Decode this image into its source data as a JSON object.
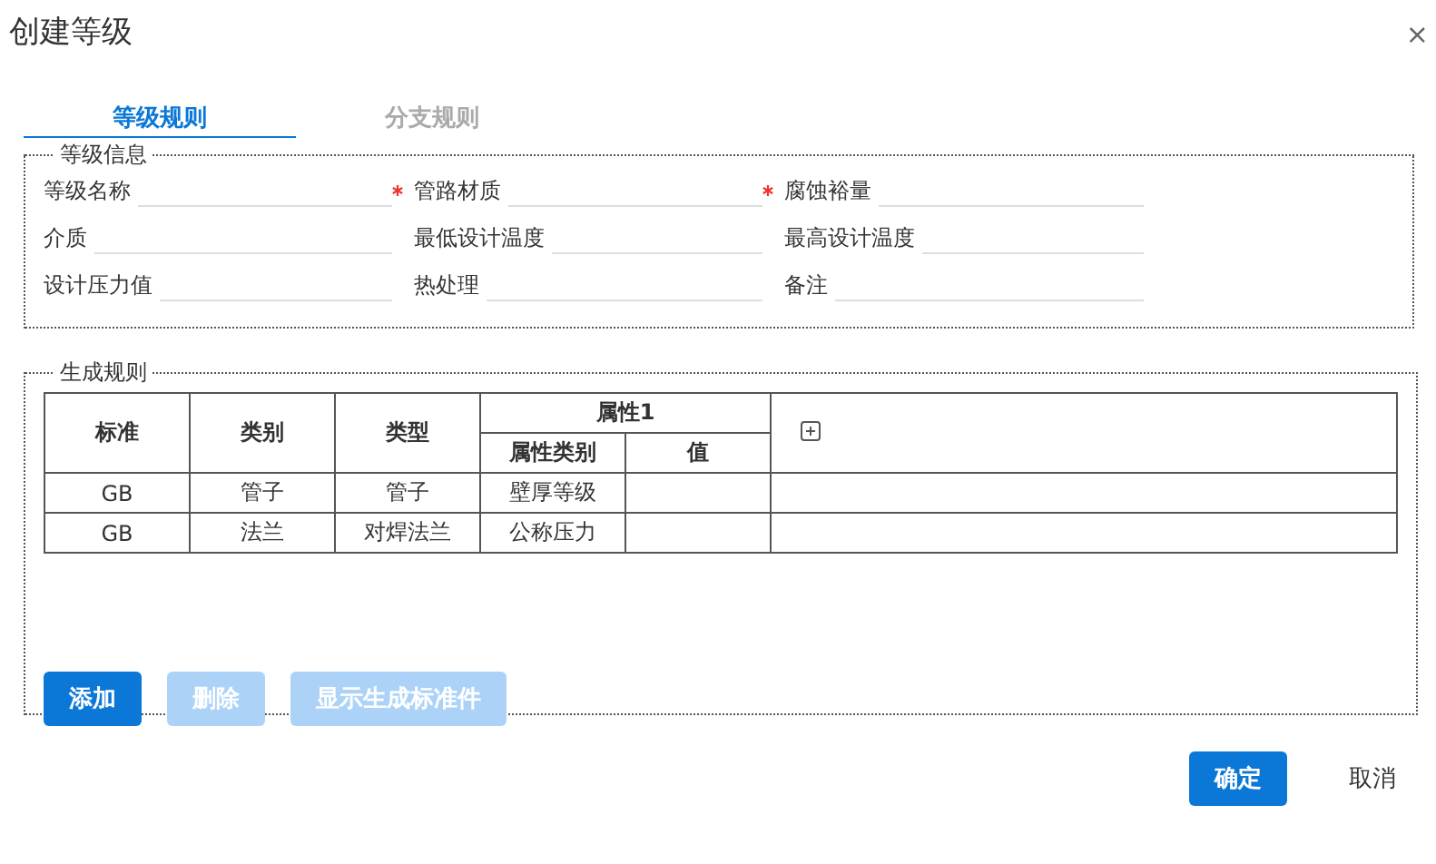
{
  "window": {
    "title": "创建等级",
    "close": "×"
  },
  "tabs": [
    {
      "label": "等级规则",
      "selected": true
    },
    {
      "label": "分支规则",
      "selected": false
    }
  ],
  "grade_info": {
    "legend": "等级信息",
    "fields": [
      {
        "label": "等级名称",
        "required": false
      },
      {
        "label": "管路材质",
        "required": true
      },
      {
        "label": "腐蚀裕量",
        "required": true
      },
      {
        "label": "介质",
        "required": false
      },
      {
        "label": "最低设计温度",
        "required": false
      },
      {
        "label": "最高设计温度",
        "required": false
      },
      {
        "label": "设计压力值",
        "required": false
      },
      {
        "label": "热处理",
        "required": false
      },
      {
        "label": "备注",
        "required": false
      }
    ]
  },
  "rules": {
    "legend": "生成规则",
    "table": {
      "columns": [
        {
          "label": "标准"
        },
        {
          "label": "类别"
        },
        {
          "label": "类型"
        },
        {
          "label": "属性1",
          "children": [
            {
              "label": "属性类别"
            },
            {
              "label": "值"
            }
          ]
        }
      ],
      "rows": [
        [
          "GB",
          "管子",
          "管子",
          "壁厚等级"
        ],
        [
          "GB",
          "法兰",
          "对焊法兰",
          "公称压力"
        ]
      ]
    },
    "buttons": [
      {
        "label": "添加",
        "disabled": false
      },
      {
        "label": "删除",
        "disabled": true
      },
      {
        "label": "显示生成标准件",
        "disabled": true
      }
    ]
  },
  "footer": {
    "buttons": [
      {
        "label": "确定",
        "kind": "primary"
      },
      {
        "label": "取消",
        "kind": "text"
      }
    ]
  }
}
